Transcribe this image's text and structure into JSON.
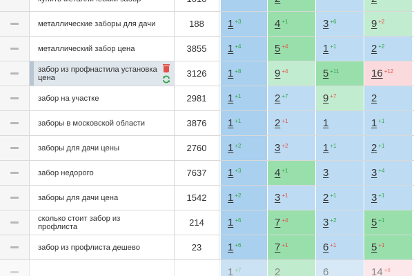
{
  "colors": {
    "blue": "#a9d0ee",
    "blue_light": "#bddcf3",
    "green": "#99dfac",
    "green_light": "#c2ecd0",
    "red_light": "#fbdadd",
    "up": "#35a64b",
    "down": "#e2504a"
  },
  "rows": [
    {
      "keyword": "купить металлический забор",
      "volume": "1010",
      "positions": [
        {
          "v": "",
          "c": "",
          "d": "",
          "bg": "#a9d0ee"
        },
        {
          "v": "2",
          "c": "",
          "d": "",
          "bg": "#99dfac"
        },
        {
          "v": "",
          "c": "",
          "d": "",
          "bg": "#bddcf3"
        },
        {
          "v": "2",
          "c": "",
          "d": "",
          "bg": "#c2ecd0"
        }
      ]
    },
    {
      "keyword": "металлические заборы для дачи",
      "volume": "188",
      "positions": [
        {
          "v": "1",
          "c": "+3",
          "d": "up",
          "bg": "#a9d0ee"
        },
        {
          "v": "4",
          "c": "+1",
          "d": "up",
          "bg": "#99dfac"
        },
        {
          "v": "3",
          "c": "+6",
          "d": "up",
          "bg": "#bddcf3"
        },
        {
          "v": "9",
          "c": "+2",
          "d": "down",
          "bg": "#c2ecd0"
        }
      ]
    },
    {
      "keyword": "металлический забор цена",
      "volume": "3855",
      "positions": [
        {
          "v": "1",
          "c": "+4",
          "d": "up",
          "bg": "#a9d0ee"
        },
        {
          "v": "5",
          "c": "+4",
          "d": "down",
          "bg": "#99dfac"
        },
        {
          "v": "1",
          "c": "+1",
          "d": "up",
          "bg": "#bddcf3"
        },
        {
          "v": "2",
          "c": "+2",
          "d": "up",
          "bg": "#bddcf3"
        }
      ]
    },
    {
      "keyword": "забор из профнастила установка цена",
      "volume": "3126",
      "selected": true,
      "positions": [
        {
          "v": "1",
          "c": "+8",
          "d": "up",
          "bg": "#a9d0ee"
        },
        {
          "v": "9",
          "c": "+4",
          "d": "down",
          "bg": "#c2ecd0"
        },
        {
          "v": "5",
          "c": "+11",
          "d": "up",
          "bg": "#99dfac"
        },
        {
          "v": "16",
          "c": "+12",
          "d": "down",
          "bg": "#fbdadd"
        }
      ]
    },
    {
      "keyword": "забор на участке",
      "volume": "2981",
      "positions": [
        {
          "v": "1",
          "c": "+1",
          "d": "up",
          "bg": "#a9d0ee"
        },
        {
          "v": "2",
          "c": "+7",
          "d": "up",
          "bg": "#bddcf3"
        },
        {
          "v": "9",
          "c": "+7",
          "d": "down",
          "bg": "#c2ecd0"
        },
        {
          "v": "2",
          "c": "",
          "d": "",
          "bg": "#bddcf3"
        }
      ]
    },
    {
      "keyword": "заборы в московской области",
      "volume": "3876",
      "positions": [
        {
          "v": "1",
          "c": "+1",
          "d": "up",
          "bg": "#a9d0ee"
        },
        {
          "v": "2",
          "c": "+1",
          "d": "down",
          "bg": "#bddcf3"
        },
        {
          "v": "1",
          "c": "",
          "d": "",
          "bg": "#bddcf3"
        },
        {
          "v": "1",
          "c": "+1",
          "d": "up",
          "bg": "#bddcf3"
        }
      ]
    },
    {
      "keyword": "заборы для дачи цены",
      "volume": "2760",
      "positions": [
        {
          "v": "1",
          "c": "+2",
          "d": "up",
          "bg": "#a9d0ee"
        },
        {
          "v": "3",
          "c": "+2",
          "d": "down",
          "bg": "#bddcf3"
        },
        {
          "v": "1",
          "c": "+1",
          "d": "up",
          "bg": "#bddcf3"
        },
        {
          "v": "2",
          "c": "+1",
          "d": "up",
          "bg": "#bddcf3"
        }
      ]
    },
    {
      "keyword": "забор недорого",
      "volume": "7637",
      "positions": [
        {
          "v": "1",
          "c": "+3",
          "d": "up",
          "bg": "#a9d0ee"
        },
        {
          "v": "4",
          "c": "+1",
          "d": "up",
          "bg": "#99dfac"
        },
        {
          "v": "3",
          "c": "",
          "d": "",
          "bg": "#bddcf3"
        },
        {
          "v": "3",
          "c": "+4",
          "d": "up",
          "bg": "#bddcf3"
        }
      ]
    },
    {
      "keyword": "заборы для дачи цена",
      "volume": "1542",
      "positions": [
        {
          "v": "1",
          "c": "+2",
          "d": "up",
          "bg": "#a9d0ee"
        },
        {
          "v": "3",
          "c": "+1",
          "d": "down",
          "bg": "#bddcf3"
        },
        {
          "v": "2",
          "c": "+1",
          "d": "up",
          "bg": "#bddcf3"
        },
        {
          "v": "3",
          "c": "+1",
          "d": "up",
          "bg": "#bddcf3"
        }
      ]
    },
    {
      "keyword": "сколько стоит забор из профлиста",
      "volume": "214",
      "positions": [
        {
          "v": "1",
          "c": "+6",
          "d": "up",
          "bg": "#a9d0ee"
        },
        {
          "v": "7",
          "c": "+4",
          "d": "down",
          "bg": "#99dfac"
        },
        {
          "v": "3",
          "c": "+2",
          "d": "up",
          "bg": "#bddcf3"
        },
        {
          "v": "5",
          "c": "+1",
          "d": "up",
          "bg": "#99dfac"
        }
      ]
    },
    {
      "keyword": "забор из профлиста дешево",
      "volume": "23",
      "positions": [
        {
          "v": "1",
          "c": "+6",
          "d": "up",
          "bg": "#a9d0ee"
        },
        {
          "v": "7",
          "c": "+1",
          "d": "down",
          "bg": "#99dfac"
        },
        {
          "v": "6",
          "c": "+1",
          "d": "down",
          "bg": "#bddcf3"
        },
        {
          "v": "5",
          "c": "+1",
          "d": "down",
          "bg": "#99dfac"
        }
      ]
    },
    {
      "keyword": "",
      "volume": "",
      "positions": [
        {
          "v": "1",
          "c": "+7",
          "d": "up",
          "bg": "#a9d0ee"
        },
        {
          "v": "2",
          "c": "",
          "d": "",
          "bg": "#99dfac"
        },
        {
          "v": "6",
          "c": "",
          "d": "",
          "bg": "#bddcf3"
        },
        {
          "v": "14",
          "c": "+8",
          "d": "down",
          "bg": "#fbdadd"
        }
      ]
    }
  ]
}
